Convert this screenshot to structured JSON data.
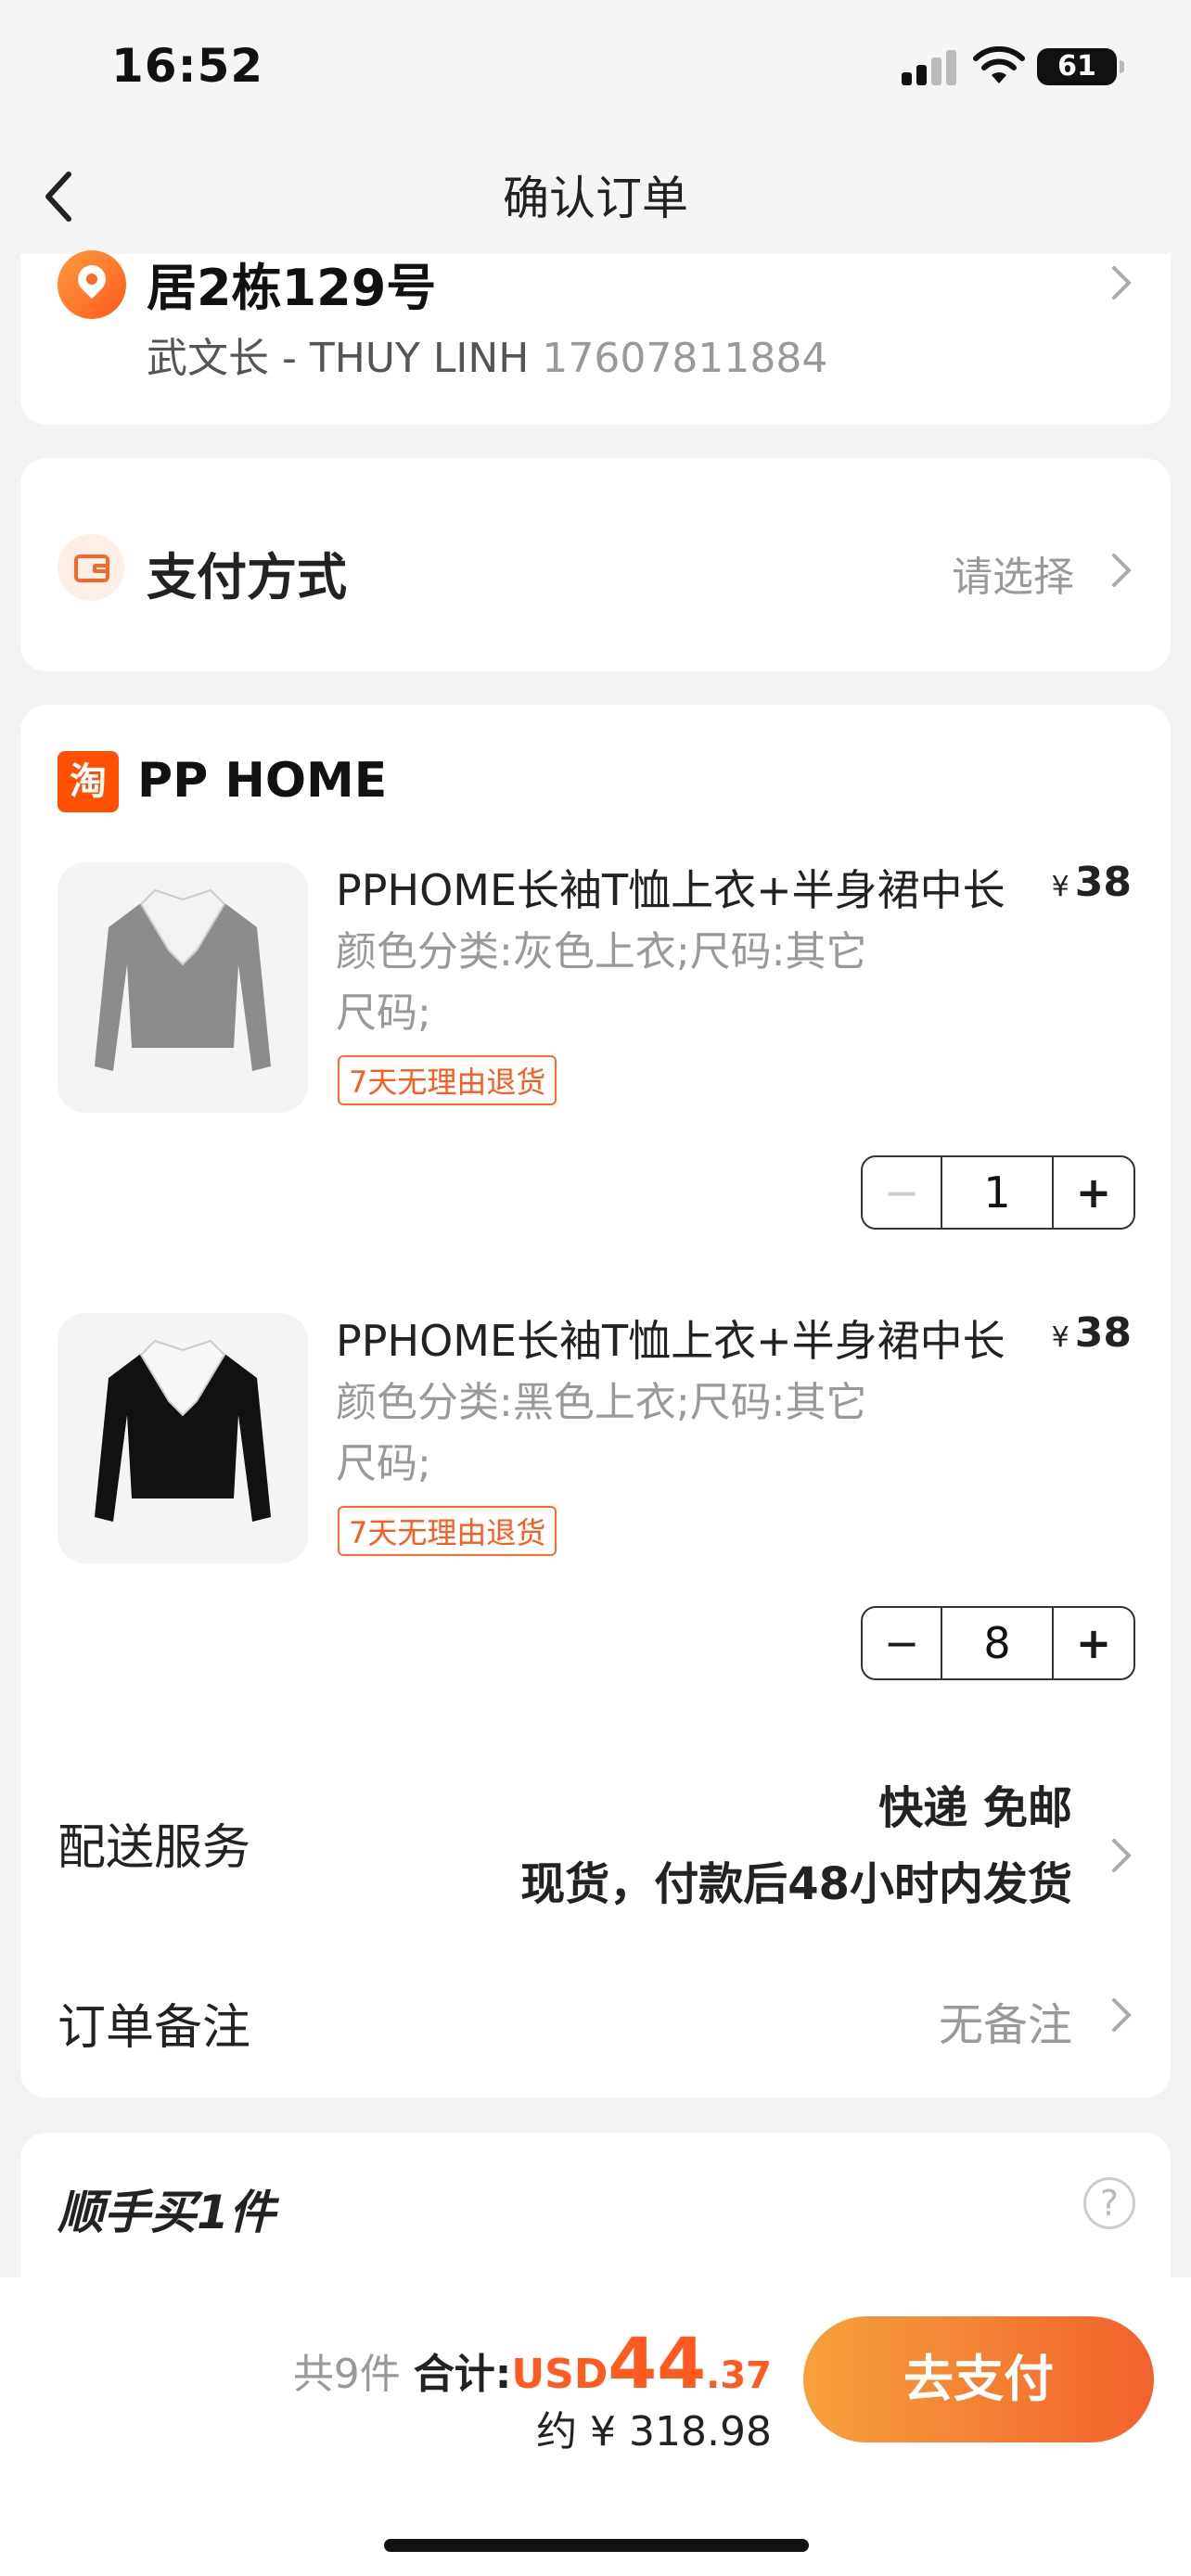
{
  "status_bar": {
    "time": "16:52",
    "battery": "61"
  },
  "nav": {
    "title": "确认订单",
    "back_icon": "chevron-left-icon"
  },
  "address": {
    "line": "居2栋129号",
    "name": "武文长 - THUY LINH",
    "phone": "17607811884",
    "icon": "location-pin-icon"
  },
  "payment": {
    "label": "支付方式",
    "placeholder": "请选择",
    "icon": "wallet-icon"
  },
  "shop": {
    "badge": "淘",
    "name": "PP HOME",
    "products": [
      {
        "title": "PPHOME长袖T恤上衣+半身裙中长",
        "currency": "¥",
        "price": "38",
        "spec_line1": "颜色分类:灰色上衣;尺码:其它",
        "spec_line2": "尺码;",
        "tag": "7天无理由退货",
        "quantity": "1",
        "minus": "−",
        "plus": "+",
        "image": "gray-top-image"
      },
      {
        "title": "PPHOME长袖T恤上衣+半身裙中长",
        "currency": "¥",
        "price": "38",
        "spec_line1": "颜色分类:黑色上衣;尺码:其它",
        "spec_line2": "尺码;",
        "tag": "7天无理由退货",
        "quantity": "8",
        "minus": "−",
        "plus": "+",
        "image": "black-top-image"
      }
    ],
    "shipping": {
      "label": "配送服务",
      "line1": "快递 免邮",
      "line2": "现货，付款后48小时内发货"
    },
    "note": {
      "label": "订单备注",
      "value": "无备注"
    }
  },
  "addon": {
    "title": "顺手买1件",
    "help": "?"
  },
  "bottom": {
    "count": "共9件",
    "total_label": "合计:",
    "currency": "USD",
    "amount_int": "44",
    "amount_dec": ".37",
    "approx": "约 ¥ 318.98",
    "pay_button": "去支付"
  },
  "colors": {
    "accent": "#ff5a1f",
    "button_start": "#f7a13b",
    "button_end": "#f2622d"
  }
}
